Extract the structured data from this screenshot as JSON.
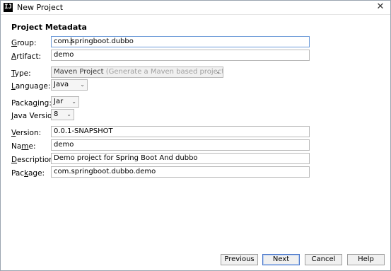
{
  "window": {
    "title": "New Project",
    "app_icon_text": "IJ",
    "close_symbol": "✕"
  },
  "section": {
    "title": "Project Metadata"
  },
  "fields": {
    "group": {
      "label_prefix": "",
      "label_underlined": "G",
      "label_rest": "roup:",
      "value_before_caret": "com.",
      "value_after_caret": "springboot.dubbo"
    },
    "artifact": {
      "label_prefix": "",
      "label_underlined": "A",
      "label_rest": "rtifact:",
      "value": "demo"
    },
    "type": {
      "label_prefix": "",
      "label_underlined": "T",
      "label_rest": "ype:",
      "selected": "Maven Project",
      "hint": "(Generate a Maven based project archive.)"
    },
    "language": {
      "label_prefix": "",
      "label_underlined": "L",
      "label_rest": "anguage:",
      "selected": "Java"
    },
    "packaging": {
      "label_prefix": "Packa",
      "label_underlined": "g",
      "label_rest": "ing:",
      "selected": "Jar"
    },
    "java_version": {
      "label_prefix": "",
      "label_underlined": "J",
      "label_rest": "ava Version:",
      "selected": "8"
    },
    "version": {
      "label_prefix": "",
      "label_underlined": "V",
      "label_rest": "ersion:",
      "value": "0.0.1-SNAPSHOT"
    },
    "name": {
      "label_prefix": "Na",
      "label_underlined": "m",
      "label_rest": "e:",
      "value": "demo"
    },
    "description": {
      "label_prefix": "",
      "label_underlined": "D",
      "label_rest": "escription:",
      "value": "Demo project for Spring Boot And dubbo"
    },
    "package": {
      "label_prefix": "Pac",
      "label_underlined": "k",
      "label_rest": "age:",
      "value": "com.springboot.dubbo.demo"
    }
  },
  "combo_arrow": "⌄",
  "buttons": {
    "previous": "Previous",
    "next": "Next",
    "cancel": "Cancel",
    "help": "Help"
  }
}
